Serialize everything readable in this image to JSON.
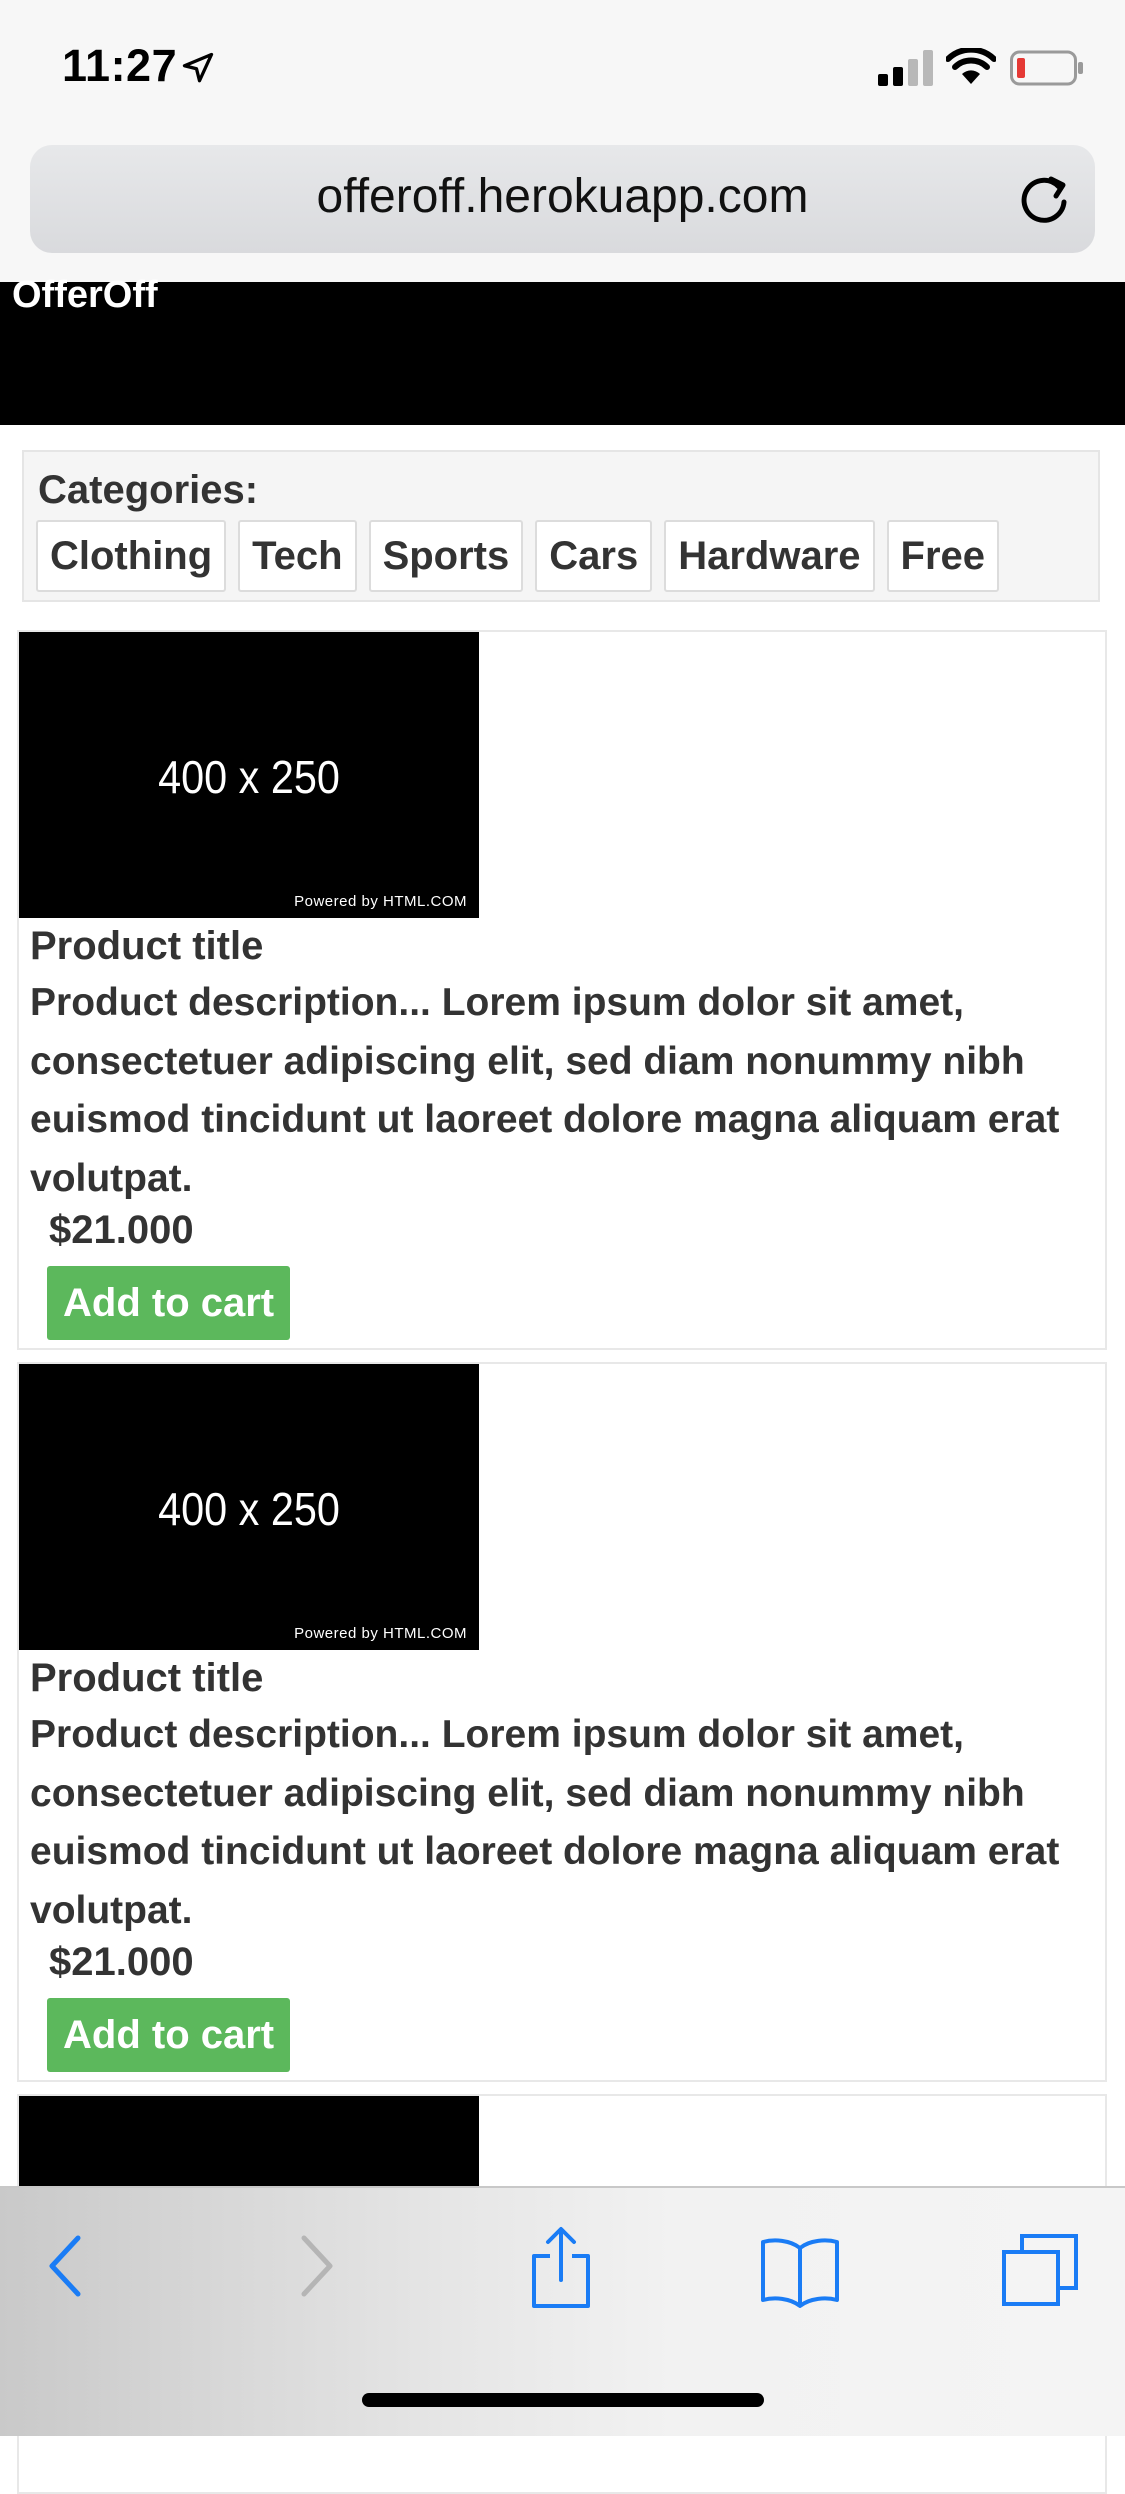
{
  "status": {
    "time": "11:27"
  },
  "browser": {
    "url": "offeroff.herokuapp.com"
  },
  "site": {
    "brand": "OfferOff"
  },
  "categories": {
    "label": "Categories:",
    "items": [
      "Clothing",
      "Tech",
      "Sports",
      "Cars",
      "Hardware",
      "Free"
    ]
  },
  "products": [
    {
      "image_text": "400 x 250",
      "image_credit": "Powered by HTML.COM",
      "title": "Product title",
      "description": "Product description... Lorem ipsum dolor sit amet, consectetuer adipiscing elit, sed diam nonummy nibh euismod tincidunt ut laoreet dolore magna aliquam erat volutpat.",
      "price": "$21.000",
      "button": "Add to cart"
    },
    {
      "image_text": "400 x 250",
      "image_credit": "Powered by HTML.COM",
      "title": "Product title",
      "description": "Product description... Lorem ipsum dolor sit amet, consectetuer adipiscing elit, sed diam nonummy nibh euismod tincidunt ut laoreet dolore magna aliquam erat volutpat.",
      "price": "$21.000",
      "button": "Add to cart"
    }
  ],
  "icons": {
    "status": [
      "location-arrow-icon",
      "cellular-signal-icon",
      "wifi-icon",
      "battery-low-icon"
    ],
    "toolbar": [
      "back-icon",
      "forward-icon",
      "share-icon",
      "bookmarks-icon",
      "tabs-icon"
    ]
  },
  "colors": {
    "header_bg": "#000000",
    "cart_button": "#5cb85c",
    "toolbar_accent": "#1a7cf5",
    "battery_low": "#e53935"
  }
}
